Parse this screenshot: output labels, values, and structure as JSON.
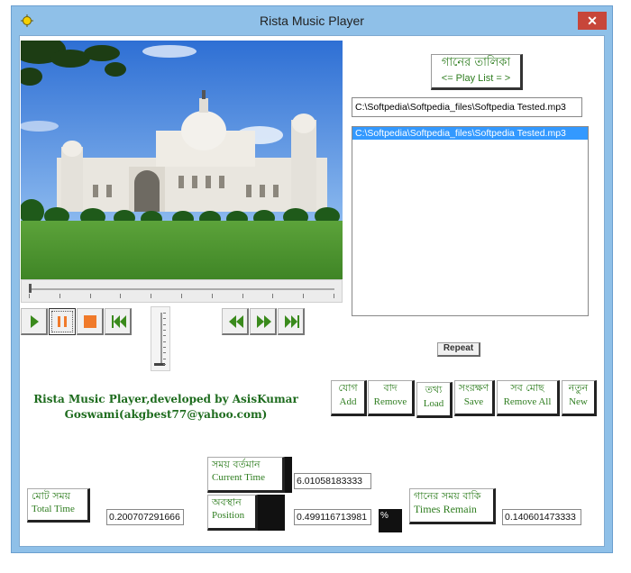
{
  "window": {
    "title": "Rista Music Player",
    "close_symbol": "✕"
  },
  "playlist": {
    "heading_bn": "গানের তালিকা",
    "heading_en": "<= Play List = >",
    "current_file": "C:\\Softpedia\\Softpedia_files\\Softpedia Tested.mp3",
    "items": [
      "C:\\Softpedia\\Softpedia_files\\Softpedia Tested.mp3"
    ]
  },
  "controls": {
    "play": "play-icon",
    "pause": "pause-icon",
    "stop": "stop-icon",
    "previous": "previous-icon",
    "rewind": "rewind-icon",
    "forward": "forward-icon",
    "next": "next-icon",
    "accent": "#3a8a1c",
    "stop_color": "#f07a2a"
  },
  "repeat_label": "Repeat",
  "developer": {
    "line1": "Rista Music Player,developed  by  AsisKumar",
    "line2": "Goswami(akgbest77@yahoo.com)"
  },
  "actions": [
    {
      "bn": "যোগ",
      "en": "Add"
    },
    {
      "bn": "বাদ",
      "en": "Remove"
    },
    {
      "bn": "তথ্য",
      "en": "Load"
    },
    {
      "bn": "সংরক্ষণ",
      "en": "Save"
    },
    {
      "bn": "সব মোছ",
      "en": "Remove All"
    },
    {
      "bn": "নতুন",
      "en": "New"
    }
  ],
  "stats": {
    "total": {
      "bn": "মোট সময়",
      "en": "Total Time",
      "value": "0.200707291666"
    },
    "current": {
      "bn": "সময় বর্তমান",
      "en": "Current Time",
      "value": "6.01058183333"
    },
    "position": {
      "bn": "অবস্থান",
      "en": "Position",
      "value": "0.499116713981"
    },
    "percent_symbol": "%",
    "remain": {
      "bn": "গানের সময় বাকি",
      "en": "Times Remain",
      "value": "0.140601473333"
    }
  }
}
